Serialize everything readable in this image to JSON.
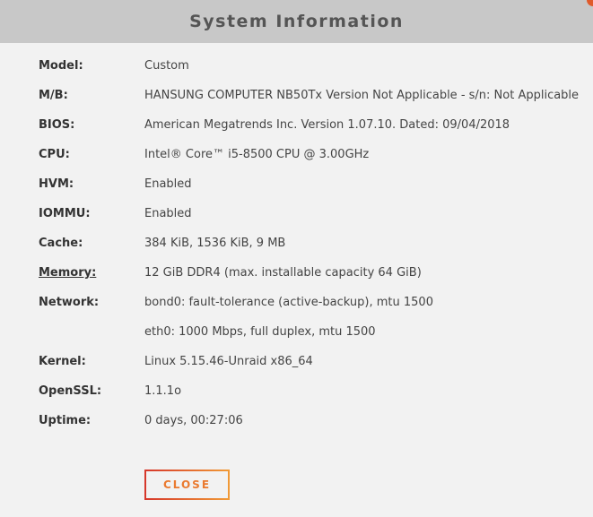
{
  "dialog": {
    "title": "System Information",
    "close_label": "CLOSE"
  },
  "rows": [
    {
      "label": "Model:",
      "value": "Custom"
    },
    {
      "label": "M/B:",
      "value": "HANSUNG COMPUTER NB50Tx Version Not Applicable - s/n: Not Applicable"
    },
    {
      "label": "BIOS:",
      "value": "American Megatrends Inc. Version 1.07.10. Dated: 09/04/2018"
    },
    {
      "label": "CPU:",
      "value": "Intel® Core™ i5-8500 CPU @ 3.00GHz"
    },
    {
      "label": "HVM:",
      "value": "Enabled"
    },
    {
      "label": "IOMMU:",
      "value": "Enabled"
    },
    {
      "label": "Cache:",
      "value": "384 KiB, 1536 KiB, 9 MB"
    },
    {
      "label": "Memory:",
      "value": "12 GiB DDR4 (max. installable capacity 64 GiB)"
    },
    {
      "label": "Network:",
      "value": "bond0: fault-tolerance (active-backup), mtu 1500"
    },
    {
      "label": "",
      "value": "eth0: 1000 Mbps, full duplex, mtu 1500"
    },
    {
      "label": "Kernel:",
      "value": "Linux 5.15.46-Unraid x86_64"
    },
    {
      "label": "OpenSSL:",
      "value": "1.1.1o"
    },
    {
      "label": "Uptime:",
      "value": "0 days, 00:27:06"
    }
  ]
}
